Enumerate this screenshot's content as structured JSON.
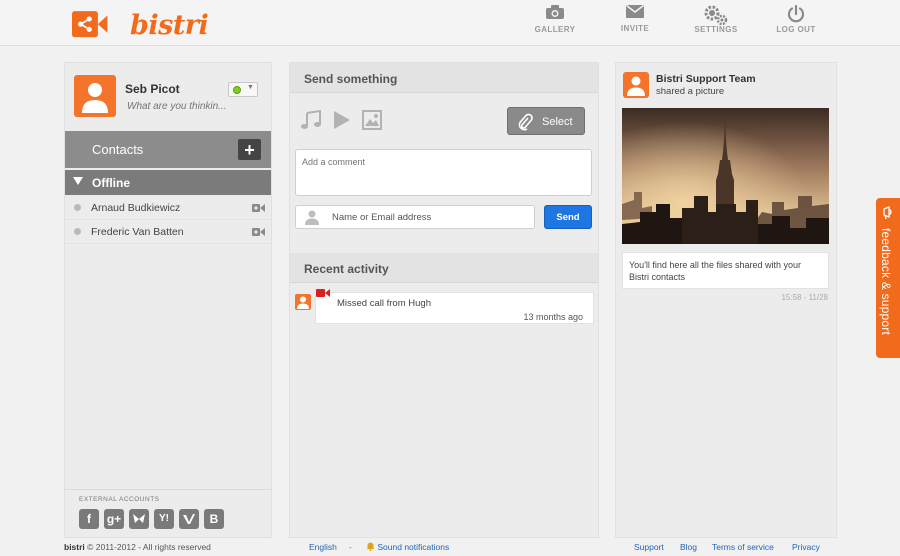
{
  "app": {
    "logo_text": "bistri",
    "brand_color": "#f26b1d"
  },
  "nav": [
    {
      "label": "GALLERY",
      "icon": "camera-icon"
    },
    {
      "label": "INVITE",
      "icon": "envelope-icon"
    },
    {
      "label": "SETTINGS",
      "icon": "gears-icon"
    },
    {
      "label": "LOG OUT",
      "icon": "power-icon"
    }
  ],
  "profile": {
    "name": "Seb Picot",
    "status_placeholder": "What are you thinkin..."
  },
  "contacts": {
    "title": "Contacts",
    "add_label": "+",
    "group_title": "Offline",
    "items": [
      {
        "name": "Arnaud Budkiewicz"
      },
      {
        "name": "Frederic Van Batten"
      }
    ]
  },
  "external_accounts": {
    "title": "EXTERNAL ACCOUNTS",
    "items": [
      {
        "glyph": "f",
        "icon": "facebook-icon"
      },
      {
        "glyph": "g+",
        "icon": "google-plus-icon"
      },
      {
        "glyph": "",
        "icon": "windows-live-icon"
      },
      {
        "glyph": "Y!",
        "icon": "yahoo-icon"
      },
      {
        "glyph": "",
        "icon": "vimeo-icon"
      },
      {
        "glyph": "B",
        "icon": "bistri-b-icon"
      }
    ]
  },
  "send": {
    "title": "Send something",
    "select_label": "Select",
    "comment_placeholder": "Add a comment",
    "recipient_placeholder": "Name or Email address",
    "send_label": "Send",
    "send_color": "#1d76e2"
  },
  "activity": {
    "title": "Recent activity",
    "items": [
      {
        "text": "Missed call from Hugh",
        "time": "13 months ago"
      }
    ]
  },
  "feed": {
    "author": "Bistri Support Team",
    "action": "shared a picture",
    "caption": "You'll find here all the files shared with your Bistri contacts",
    "time": "15:58 - 11/28"
  },
  "feedback": {
    "label": "feedback & support"
  },
  "footer": {
    "brand": "bistri",
    "copyright": "© 2011-2012 - All rights reserved",
    "language": "English",
    "separator": "-",
    "sound": "Sound notifications",
    "links": [
      "Support",
      "Blog",
      "Terms of service",
      "Privacy"
    ]
  }
}
